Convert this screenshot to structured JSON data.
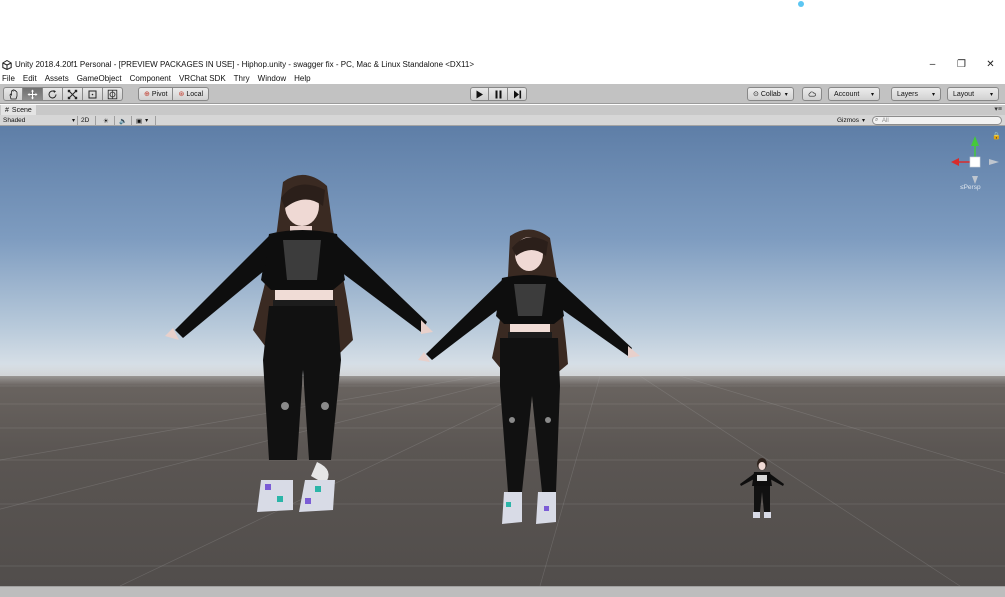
{
  "window": {
    "title": "Unity 2018.4.20f1 Personal - [PREVIEW PACKAGES IN USE] - Hiphop.unity - swagger fix - PC, Mac & Linux Standalone <DX11>",
    "controls": {
      "minimize": "–",
      "restore": "❐",
      "close": "✕"
    }
  },
  "menu": [
    "File",
    "Edit",
    "Assets",
    "GameObject",
    "Component",
    "VRChat SDK",
    "Thry",
    "Window",
    "Help"
  ],
  "toolbar": {
    "tools": [
      {
        "name": "hand-tool",
        "icon": "hand-icon",
        "active": false
      },
      {
        "name": "move-tool",
        "icon": "move-arrows-icon",
        "active": true
      },
      {
        "name": "rotate-tool",
        "icon": "rotate-icon",
        "active": false
      },
      {
        "name": "scale-tool",
        "icon": "scale-icon",
        "active": false
      },
      {
        "name": "rect-tool",
        "icon": "rect-icon",
        "active": false
      },
      {
        "name": "transform-tool",
        "icon": "transform-icon",
        "active": false
      }
    ],
    "pivot_label": "Pivot",
    "local_label": "Local",
    "collab_label": "Collab",
    "account_label": "Account",
    "layers_label": "Layers",
    "layout_label": "Layout"
  },
  "scene_tab": {
    "label": "Scene",
    "icon": "hash-grid-icon"
  },
  "scene_toolbar": {
    "shading_mode": "Shaded",
    "mode_2d": "2D",
    "gizmos_label": "Gizmos",
    "search_placeholder": "All"
  },
  "scene_view": {
    "projection_label": "Persp",
    "avatars": [
      {
        "label": "avatar-large",
        "scale": 1.0
      },
      {
        "label": "avatar-medium",
        "scale": 0.82
      },
      {
        "label": "avatar-small",
        "scale": 0.22
      }
    ]
  },
  "colors": {
    "toolbar_bg": "#c2c2c2",
    "sky_top": "#5e7ea7",
    "ground": "#5b5653",
    "gizmo_x": "#d92b2b",
    "gizmo_y": "#45c93a",
    "gizmo_z": "#3b6fd6"
  }
}
